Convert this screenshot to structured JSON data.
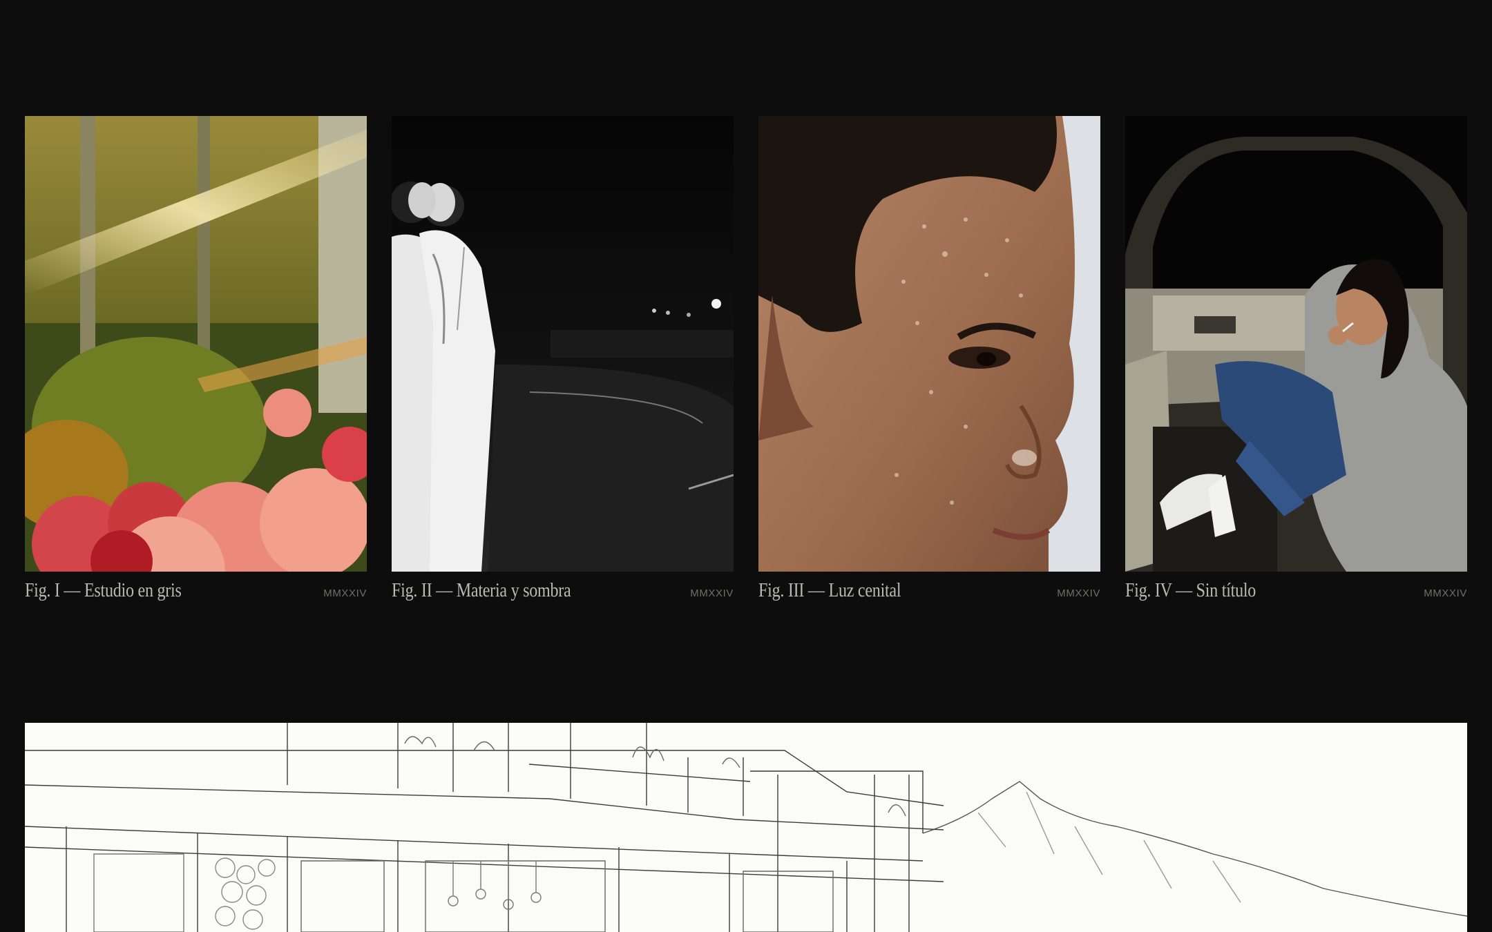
{
  "figures": [
    {
      "title": "Fig. I — Estudio en gris",
      "year": "MMXXIV",
      "image_label": "sunlit garden with pink roses"
    },
    {
      "title": "Fig. II — Materia y sombra",
      "year": "MMXXIV",
      "image_label": "black and white couple at night road"
    },
    {
      "title": "Fig. III — Luz cenital",
      "year": "MMXXIV",
      "image_label": "close-up portrait with water droplets"
    },
    {
      "title": "Fig. IV — Sin título",
      "year": "MMXXIV",
      "image_label": "woman in grey hoodie in car at night"
    }
  ],
  "feature": {
    "image_label": "architectural pencil sketch of villa with mountains"
  },
  "colors": {
    "background": "#0d0d0d",
    "caption_text": "#b9b9b5",
    "caption_meta": "#6f6f6c"
  }
}
